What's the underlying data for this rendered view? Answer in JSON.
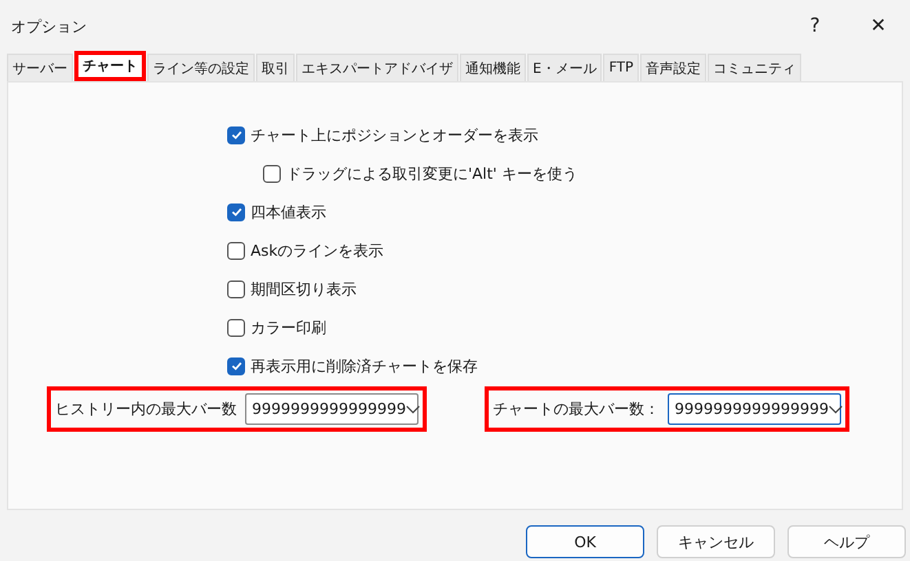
{
  "window": {
    "title": "オプション",
    "help": "?",
    "close": "✕"
  },
  "tabs": [
    {
      "label": "サーバー",
      "selected": false,
      "highlighted": false
    },
    {
      "label": "チャート",
      "selected": true,
      "highlighted": true
    },
    {
      "label": "ライン等の設定",
      "selected": false,
      "highlighted": false
    },
    {
      "label": "取引",
      "selected": false,
      "highlighted": false
    },
    {
      "label": "エキスパートアドバイザ",
      "selected": false,
      "highlighted": false
    },
    {
      "label": "通知機能",
      "selected": false,
      "highlighted": false
    },
    {
      "label": "E・メール",
      "selected": false,
      "highlighted": false
    },
    {
      "label": "FTP",
      "selected": false,
      "highlighted": false
    },
    {
      "label": "音声設定",
      "selected": false,
      "highlighted": false
    },
    {
      "label": "コミュニティ",
      "selected": false,
      "highlighted": false
    }
  ],
  "options": [
    {
      "label": "チャート上にポジションとオーダーを表示",
      "checked": true,
      "children": [
        {
          "label": "ドラッグによる取引変更に'Alt' キーを使う",
          "checked": false
        }
      ]
    },
    {
      "label": "四本値表示",
      "checked": true
    },
    {
      "label": "Askのラインを表示",
      "checked": false
    },
    {
      "label": "期間区切り表示",
      "checked": false
    },
    {
      "label": "カラー印刷",
      "checked": false
    },
    {
      "label": "再表示用に削除済チャートを保存",
      "checked": true
    }
  ],
  "fields": [
    {
      "label": "ヒストリー内の最大バー数",
      "value": "9999999999999999",
      "focused": false,
      "highlighted": true
    },
    {
      "label": "チャートの最大バー数：",
      "value": "9999999999999999",
      "focused": true,
      "highlighted": true
    }
  ],
  "buttons": [
    {
      "label": "OK",
      "default": true
    },
    {
      "label": "キャンセル",
      "default": false
    },
    {
      "label": "ヘルプ",
      "default": false
    }
  ]
}
